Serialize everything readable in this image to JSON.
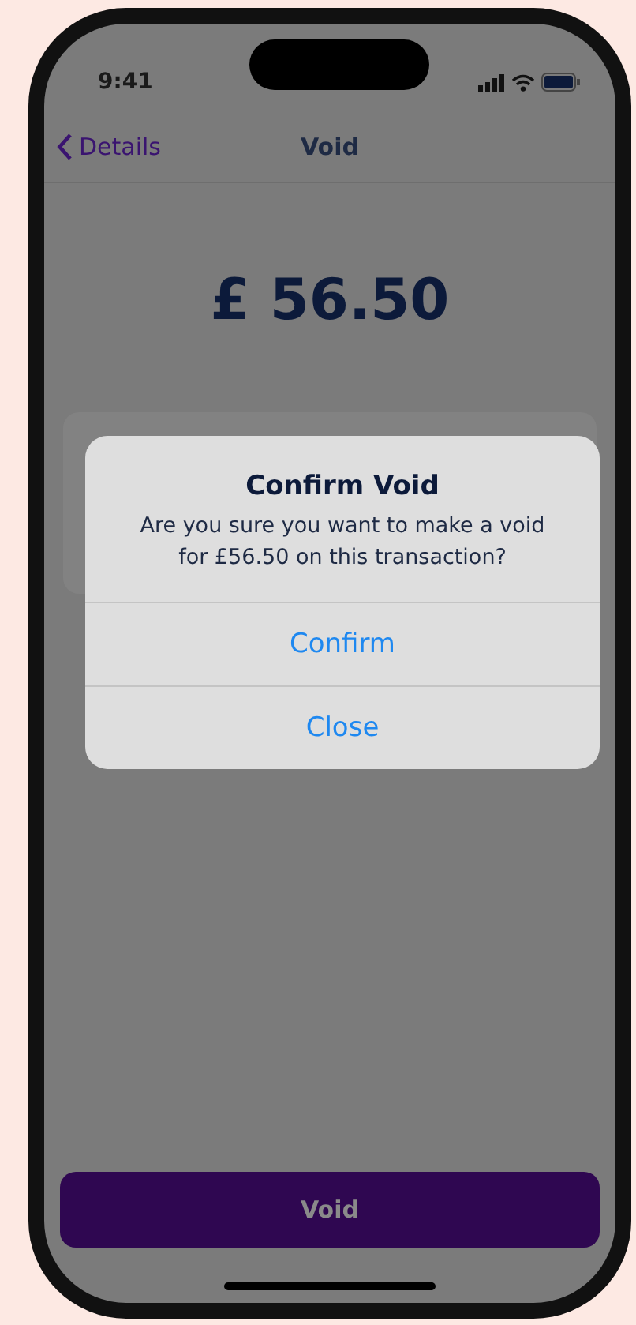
{
  "status_bar": {
    "time": "9:41"
  },
  "nav": {
    "back": "Details",
    "title": "Void"
  },
  "amount": "£ 56.50",
  "dialog": {
    "title": "Confirm Void",
    "message": "Are you sure you want to make a void for £56.50 on this transaction?",
    "actions": [
      "Confirm",
      "Close"
    ]
  },
  "primary_button": "Void"
}
